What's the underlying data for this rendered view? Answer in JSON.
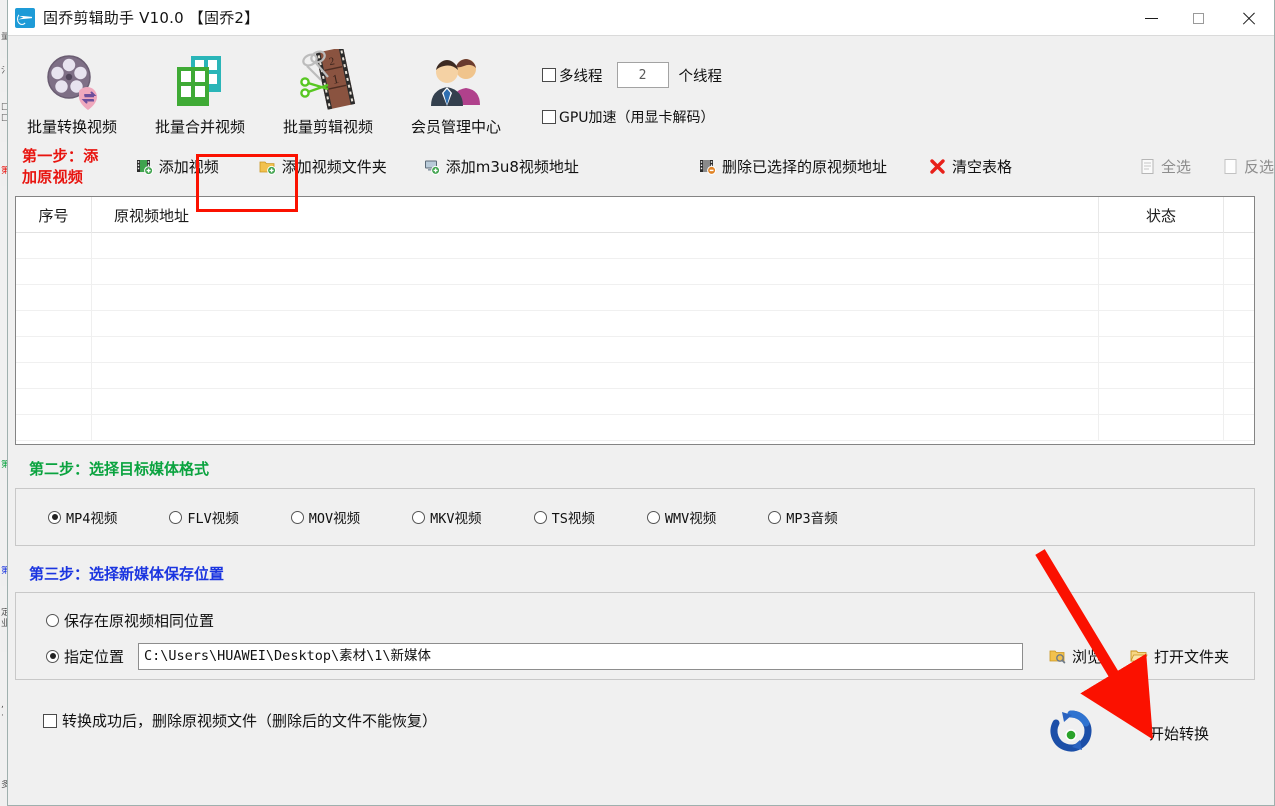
{
  "window": {
    "title": "固乔剪辑助手 V10.0 【固乔2】",
    "app_icon": "scissors-video-icon",
    "minimize_label": "—",
    "maximize_label": "□",
    "close_label": "✕"
  },
  "toolbar": {
    "items": [
      {
        "label": "批量转换视频",
        "icon": "film-reel-convert-icon"
      },
      {
        "label": "批量合并视频",
        "icon": "merge-blocks-icon"
      },
      {
        "label": "批量剪辑视频",
        "icon": "film-strip-scissors-icon"
      },
      {
        "label": "会员管理中心",
        "icon": "members-icon"
      }
    ],
    "multithread": {
      "label": "多线程",
      "checked": false,
      "value": "2",
      "unit_label": "个线程"
    },
    "gpu": {
      "label": "GPU加速（用显卡解码）",
      "checked": false
    }
  },
  "step1": {
    "title": "第一步：添加原视频",
    "actions": [
      {
        "label": "添加视频",
        "icon": "add-video-icon",
        "dim": false
      },
      {
        "label": "添加视频文件夹",
        "icon": "add-folder-icon",
        "dim": false
      },
      {
        "label": "添加m3u8视频地址",
        "icon": "add-m3u8-icon",
        "dim": false
      },
      {
        "label": "删除已选择的原视频地址",
        "icon": "delete-selected-icon",
        "dim": false
      },
      {
        "label": "清空表格",
        "icon": "clear-table-x-icon",
        "dim": false
      },
      {
        "label": "全选",
        "icon": "select-all-icon",
        "dim": true
      },
      {
        "label": "反选",
        "icon": "invert-selection-icon",
        "dim": true
      }
    ]
  },
  "table": {
    "columns": [
      "序号",
      "原视频地址",
      "状态",
      ""
    ],
    "rows": [],
    "empty_row_count": 8
  },
  "step2": {
    "title": "第二步：选择目标媒体格式",
    "formats": [
      {
        "label": "MP4视频",
        "selected": true
      },
      {
        "label": "FLV视频",
        "selected": false
      },
      {
        "label": "MOV视频",
        "selected": false
      },
      {
        "label": "MKV视频",
        "selected": false
      },
      {
        "label": "TS视频",
        "selected": false
      },
      {
        "label": "WMV视频",
        "selected": false
      },
      {
        "label": "MP3音频",
        "selected": false
      }
    ]
  },
  "step3": {
    "title": "第三步：选择新媒体保存位置",
    "same_location": {
      "label": "保存在原视频相同位置",
      "selected": false
    },
    "custom_location": {
      "label": "指定位置",
      "selected": true
    },
    "path_value": "C:\\Users\\HUAWEI\\Desktop\\素材\\1\\新媒体",
    "browse_label": "浏览",
    "open_folder_label": "打开文件夹"
  },
  "bottom": {
    "delete_after": {
      "label": "转换成功后，删除原视频文件（删除后的文件不能恢复）",
      "checked": false
    },
    "start_label": "开始转换",
    "start_icon": "refresh-circle-icon"
  },
  "annotations": {
    "highlight_box_target": "添加视频",
    "arrow_target": "开始转换",
    "color": "#fb1100"
  }
}
